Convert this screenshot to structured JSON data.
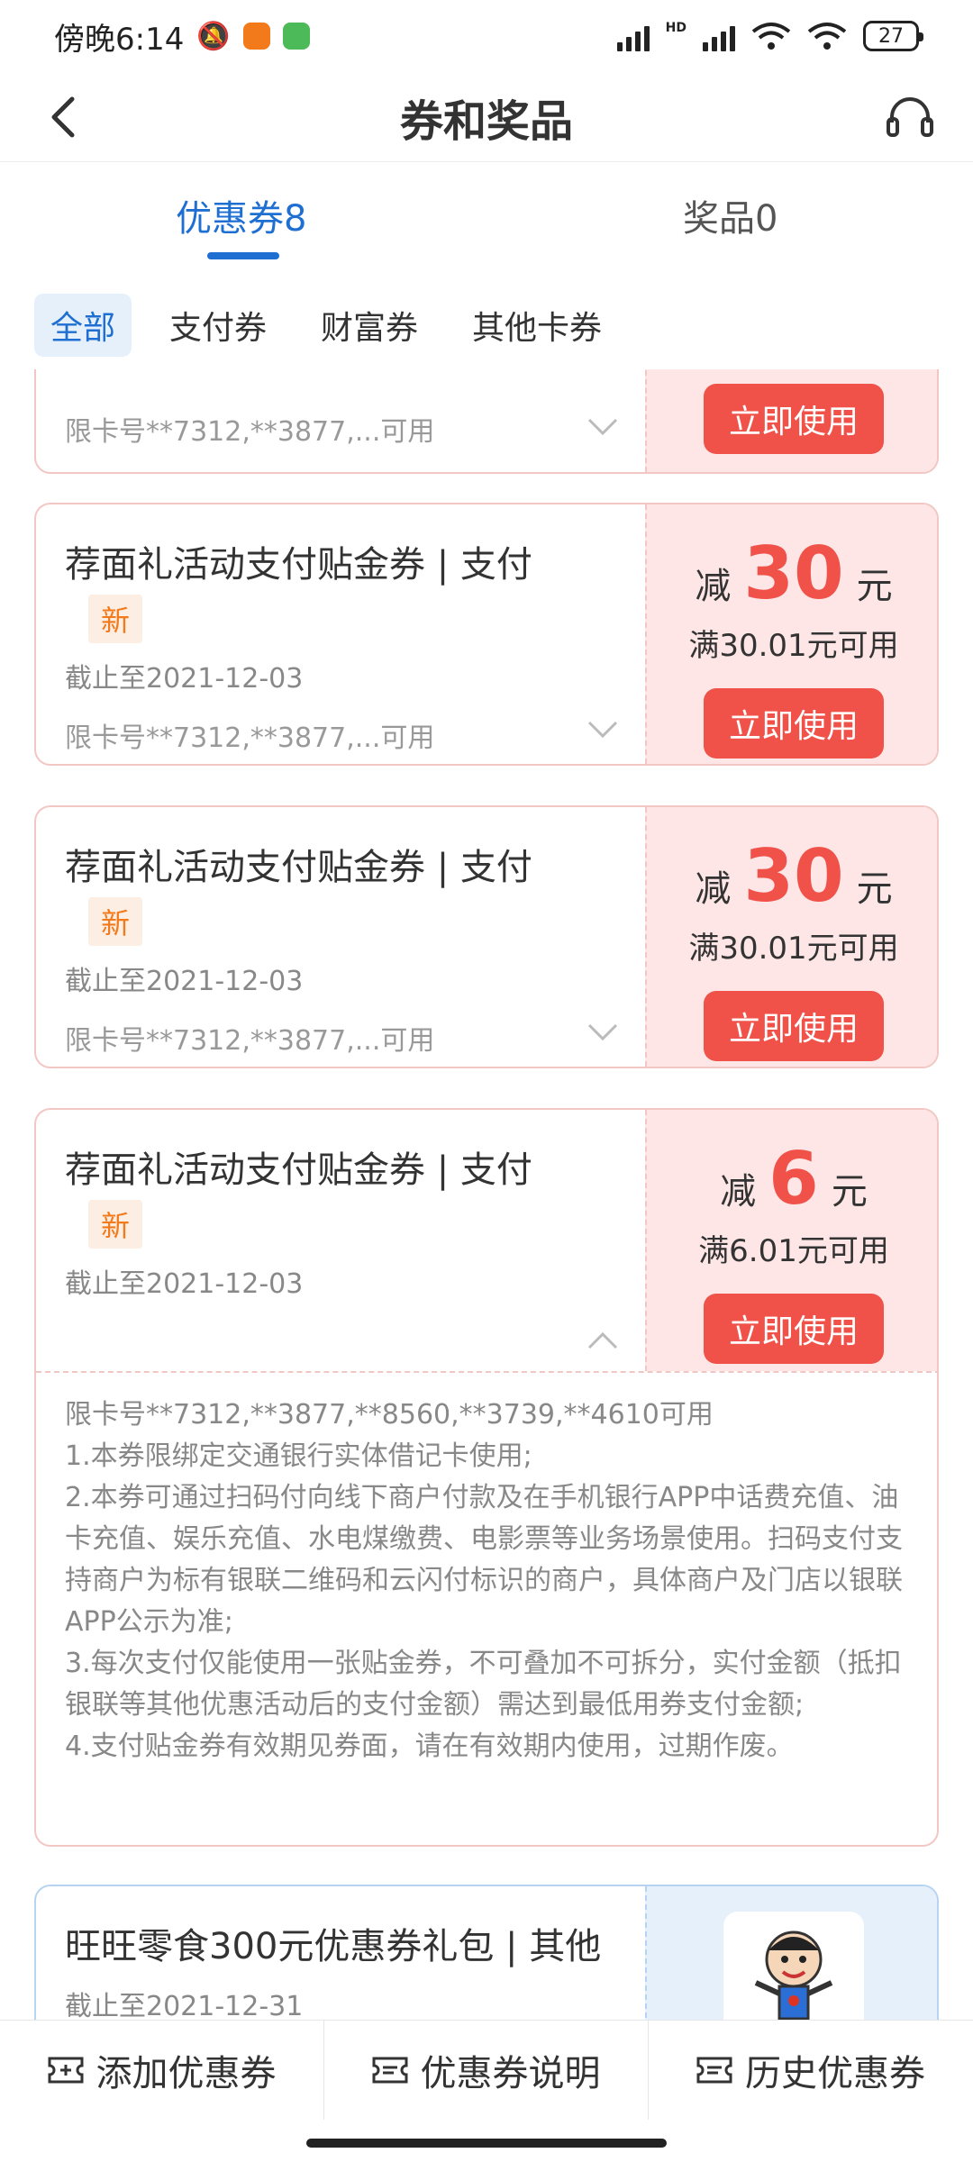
{
  "status_bar": {
    "time": "傍晚6:14",
    "battery": "27",
    "hd_label": "HD"
  },
  "header": {
    "title": "券和奖品"
  },
  "tabs": [
    {
      "label": "优惠券8",
      "active": true
    },
    {
      "label": "奖品0",
      "active": false
    }
  ],
  "filters": [
    {
      "label": "全部",
      "active": true
    },
    {
      "label": "支付券"
    },
    {
      "label": "财富券"
    },
    {
      "label": "其他卡券"
    }
  ],
  "coupons": [
    {
      "cards": "限卡号**7312,**3877,...可用",
      "button": "立即使用"
    },
    {
      "title": "荐面礼活动支付贴金券 | 支付",
      "badge": "新",
      "expiry": "截止至2021-12-03",
      "cards": "限卡号**7312,**3877,...可用",
      "amount_prefix": "减",
      "amount": "30",
      "unit": "元",
      "condition": "满30.01元可用",
      "button": "立即使用"
    },
    {
      "title": "荐面礼活动支付贴金券 | 支付",
      "badge": "新",
      "expiry": "截止至2021-12-03",
      "cards": "限卡号**7312,**3877,...可用",
      "amount_prefix": "减",
      "amount": "30",
      "unit": "元",
      "condition": "满30.01元可用",
      "button": "立即使用"
    },
    {
      "title": "荐面礼活动支付贴金券 | 支付",
      "badge": "新",
      "expiry": "截止至2021-12-03",
      "amount_prefix": "减",
      "amount": "6",
      "unit": "元",
      "condition": "满6.01元可用",
      "button": "立即使用",
      "details": [
        "限卡号**7312,**3877,**8560,**3739,**4610可用",
        "1.本券限绑定交通银行实体借记卡使用;",
        "2.本券可通过扫码付向线下商户付款及在手机银行APP中话费充值、油卡充值、娱乐充值、水电煤缴费、电影票等业务场景使用。扫码支付支持商户为标有银联二维码和云闪付标识的商户，具体商户及门店以银联APP公示为准;",
        "3.每次支付仅能使用一张贴金券，不可叠加不可拆分，实付金额（抵扣银联等其他优惠活动后的支付金额）需达到最低用券支付金额;",
        "4.支付贴金券有效期见券面，请在有效期内使用，过期作废。"
      ]
    },
    {
      "title": "旺旺零食300元优惠券礼包 | 其他",
      "expiry": "截止至2021-12-31"
    }
  ],
  "bottom_bar": [
    {
      "label": "添加优惠券"
    },
    {
      "label": "优惠券说明"
    },
    {
      "label": "历史优惠券"
    }
  ]
}
